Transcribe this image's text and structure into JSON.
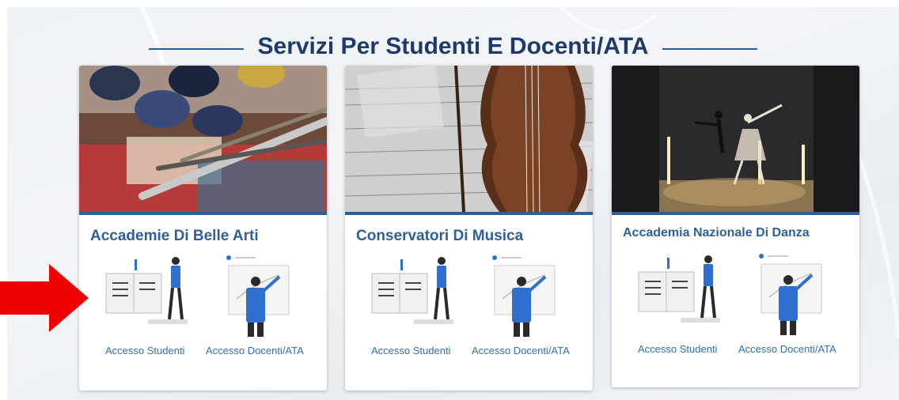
{
  "section_title": "Servizi Per Studenti E Docenti/ATA",
  "colors": {
    "brand": "#2f5f9b",
    "title": "#1d3a6b",
    "link": "#2f6fb6",
    "arrow": "#ee0000",
    "illustration_accent": "#2f6fd0"
  },
  "cards": [
    {
      "title": "Accademie Di Belle Arti",
      "photo": "paint-palette-photo",
      "student_link": "Accesso Studenti",
      "staff_link": "Accesso Docenti/ATA"
    },
    {
      "title": "Conservatori Di Musica",
      "photo": "violin-sheet-music-photo",
      "student_link": "Accesso Studenti",
      "staff_link": "Accesso Docenti/ATA"
    },
    {
      "title": "Accademia Nazionale Di Danza",
      "photo": "ballet-dancers-photo",
      "student_link": "Accesso Studenti",
      "staff_link": "Accesso Docenti/ATA"
    }
  ],
  "annotation": "red-arrow-pointer"
}
